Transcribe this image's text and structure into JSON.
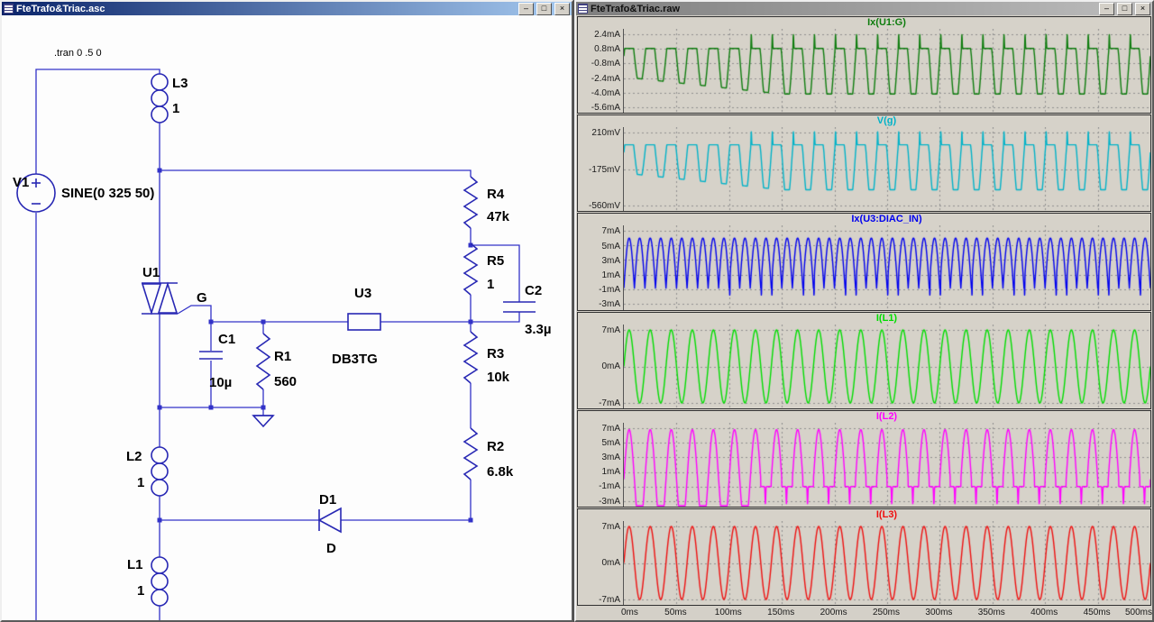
{
  "left_window": {
    "title": "FteTrafo&Triac.asc",
    "active": true
  },
  "right_window": {
    "title": "FteTrafo&Triac.raw",
    "active": false
  },
  "window_controls": {
    "minimize": "–",
    "maximize": "□",
    "close": "×"
  },
  "schematic": {
    "directive": ".tran 0 .5 0",
    "labels": {
      "v1_name": "V1",
      "v1_value": "SINE(0 325 50)",
      "l3_name": "L3",
      "l3_value": "1",
      "l2_name": "L2",
      "l2_value": "1",
      "l1_name": "L1",
      "l1_value": "1",
      "u1_name": "U1",
      "gate_net": "G",
      "c1_name": "C1",
      "c1_value": "10µ",
      "r1_name": "R1",
      "r1_value": "560",
      "u3_name": "U3",
      "u3_value": "DB3TG",
      "r4_name": "R4",
      "r4_value": "47k",
      "r5_name": "R5",
      "r5_value": "1",
      "c2_name": "C2",
      "c2_value": "3.3µ",
      "r3_name": "R3",
      "r3_value": "10k",
      "r2_name": "R2",
      "r2_value": "6.8k",
      "d1_name": "D1",
      "d1_value": "D"
    }
  },
  "x_axis": {
    "tick_labels": [
      "0ms",
      "50ms",
      "100ms",
      "150ms",
      "200ms",
      "250ms",
      "300ms",
      "350ms",
      "400ms",
      "450ms",
      "500ms"
    ],
    "tick_values_ms": [
      0,
      50,
      100,
      150,
      200,
      250,
      300,
      350,
      400,
      450,
      500
    ]
  },
  "chart_data": [
    {
      "type": "line",
      "title": "Ix(U1:G)",
      "color": "#0d7c0d",
      "x_range_ms": [
        0,
        500
      ],
      "y_tick_labels": [
        "2.4mA",
        "0.8mA",
        "-0.8mA",
        "-2.4mA",
        "-4.0mA",
        "-5.6mA"
      ],
      "y_tick_values": [
        2.4,
        0.8,
        -0.8,
        -2.4,
        -4.0,
        -5.6
      ],
      "y_range": [
        -5.6,
        2.4
      ],
      "unit": "mA",
      "grid": true,
      "waveform": {
        "kind": "gate",
        "freq_hz": 50,
        "pos_clip_mA": 0.85,
        "neg_clip_mA": -4.15,
        "spike_peak_mA": 2.35
      }
    },
    {
      "type": "line",
      "title": "V(g)",
      "color": "#00b2c8",
      "x_range_ms": [
        0,
        500
      ],
      "y_tick_labels": [
        "210mV",
        "-175mV",
        "-560mV"
      ],
      "y_tick_values": [
        210,
        -175,
        -560
      ],
      "y_range": [
        -560,
        210
      ],
      "unit": "mV",
      "grid": true,
      "waveform": {
        "kind": "gate_scaled",
        "freq_hz": 50,
        "pos_clip_mA": 0.85,
        "neg_clip_mA": -4.15,
        "spike_peak_mA": 2.3,
        "scale_mV_per_mA": 95
      }
    },
    {
      "type": "line",
      "title": "Ix(U3:DIAC_IN)",
      "color": "#0000ee",
      "x_range_ms": [
        0,
        500
      ],
      "y_tick_labels": [
        "7mA",
        "5mA",
        "3mA",
        "1mA",
        "-1mA",
        "-3mA"
      ],
      "y_tick_values": [
        7,
        5,
        3,
        1,
        -1,
        -3
      ],
      "y_range": [
        -3,
        7
      ],
      "unit": "mA",
      "grid": true,
      "waveform": {
        "kind": "diac",
        "freq_hz": 50,
        "peak_mA": 6.0,
        "base_mA": -0.85,
        "spike_mA": -3.2
      }
    },
    {
      "type": "line",
      "title": "I(L1)",
      "color": "#00dd00",
      "x_range_ms": [
        0,
        500
      ],
      "y_tick_labels": [
        "7mA",
        "0mA",
        "-7mA"
      ],
      "y_tick_values": [
        7,
        0,
        -7
      ],
      "y_range": [
        -7,
        7
      ],
      "unit": "mA",
      "grid": true,
      "waveform": {
        "kind": "sine",
        "freq_hz": 50,
        "amplitude_mA": 7,
        "phase_deg": 0
      }
    },
    {
      "type": "line",
      "title": "I(L2)",
      "color": "#ff00ff",
      "x_range_ms": [
        0,
        500
      ],
      "y_tick_labels": [
        "7mA",
        "5mA",
        "3mA",
        "1mA",
        "-1mA",
        "-3mA"
      ],
      "y_tick_values": [
        7,
        5,
        3,
        1,
        -1,
        -3
      ],
      "y_range": [
        -3,
        7
      ],
      "unit": "mA",
      "grid": true,
      "waveform": {
        "kind": "l2",
        "freq_hz": 50,
        "peak_mA": 6.8,
        "settle_ms": 130,
        "flat_mA": -1.0,
        "spike_mA": -3.4
      }
    },
    {
      "type": "line",
      "title": "I(L3)",
      "color": "#ee1010",
      "x_range_ms": [
        0,
        500
      ],
      "y_tick_labels": [
        "7mA",
        "0mA",
        "-7mA"
      ],
      "y_tick_values": [
        7,
        0,
        -7
      ],
      "y_range": [
        -7,
        7
      ],
      "unit": "mA",
      "grid": true,
      "waveform": {
        "kind": "sine",
        "freq_hz": 50,
        "amplitude_mA": 7,
        "phase_deg": 0
      }
    }
  ]
}
